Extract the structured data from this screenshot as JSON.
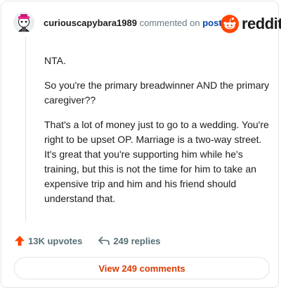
{
  "header": {
    "username": "curiouscapybara1989",
    "commented_text": "commented on",
    "post_link": "post",
    "brand": "reddit"
  },
  "comment": {
    "paragraphs": [
      "NTA.",
      "So you're the primary breadwinner AND the primary caregiver??",
      "That's a lot of money just to go to a wedding. You're right to be upset OP. Marriage is a two-way street. It's great that you're supporting him while he's training, but this is not the time for him to take an expensive trip and him and his friend should understand that."
    ]
  },
  "actions": {
    "upvotes": "13K upvotes",
    "replies": "249 replies"
  },
  "view_comments": "View 249 comments",
  "colors": {
    "brand_orange": "#ff4500",
    "upvote_orange": "#ff4500",
    "link_blue": "#0045ac",
    "view_button_text": "#d93a00"
  },
  "icons": {
    "avatar": "snoo-avatar-icon",
    "brand": "reddit-snoo-icon",
    "upvote": "upvote-arrow-icon",
    "reply": "reply-arrow-icon"
  }
}
